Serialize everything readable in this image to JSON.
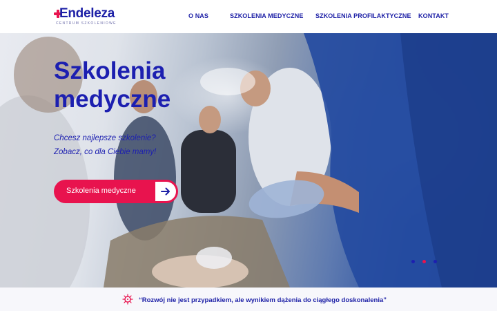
{
  "logo": {
    "name": "Endeleza",
    "tagline": "CENTRUM SZKOLENIOWE",
    "accent": "#e8134e"
  },
  "nav": {
    "items": [
      {
        "label": "O NAS"
      },
      {
        "label": "SZKOLENIA MEDYCZNE"
      },
      {
        "label": "SZKOLENIA PROFILAKTYCZNE"
      },
      {
        "label": "KONTAKT"
      }
    ]
  },
  "hero": {
    "title": "Szkolenia medyczne",
    "subtitle_line1": "Chcesz najlepsze szkolenie?",
    "subtitle_line2": "Zobacz, co dla Ciebie mamy!",
    "cta_label": "Szkolenia medyczne",
    "cta_icon": "arrow-right-icon",
    "image": "medical-team-resuscitation-photo",
    "slides": {
      "count": 3,
      "active": 2
    }
  },
  "quote": {
    "text": "“Rozwój nie jest przypadkiem, ale wynikiem dążenia do ciągłego doskonalenia”",
    "icon": "virus-icon"
  },
  "colors": {
    "brand_blue": "#1c1fa6",
    "brand_red": "#e8134e",
    "dot_blue": "#1c1fb0"
  }
}
